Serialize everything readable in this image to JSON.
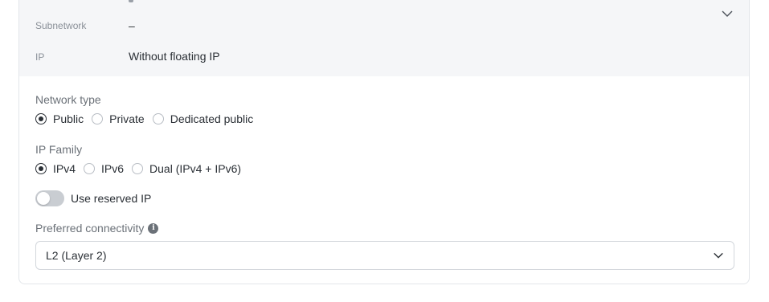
{
  "summary": {
    "rows": [
      {
        "key": "Subnetwork",
        "value": "–"
      },
      {
        "key": "IP",
        "value": "Without floating IP"
      }
    ],
    "toggle_icon": "chevron-down-icon"
  },
  "network_type": {
    "label": "Network type",
    "options": [
      {
        "label": "Public",
        "checked": true
      },
      {
        "label": "Private",
        "checked": false
      },
      {
        "label": "Dedicated public",
        "checked": false
      }
    ]
  },
  "ip_family": {
    "label": "IP Family",
    "options": [
      {
        "label": "IPv4",
        "checked": true
      },
      {
        "label": "IPv6",
        "checked": false
      },
      {
        "label": "Dual (IPv4 + IPv6)",
        "checked": false
      }
    ]
  },
  "reserved_ip": {
    "label": "Use reserved IP",
    "enabled": false
  },
  "preferred_connectivity": {
    "label": "Preferred connectivity",
    "info_icon": "info-icon",
    "selected": "L2 (Layer 2)",
    "dropdown_icon": "chevron-down-icon"
  },
  "colors": {
    "text": "#2a2f35",
    "muted": "#8a9098",
    "summary_bg": "#f5f6f8",
    "toggle_off": "#c9cdd2",
    "border": "#d3d7dc"
  }
}
